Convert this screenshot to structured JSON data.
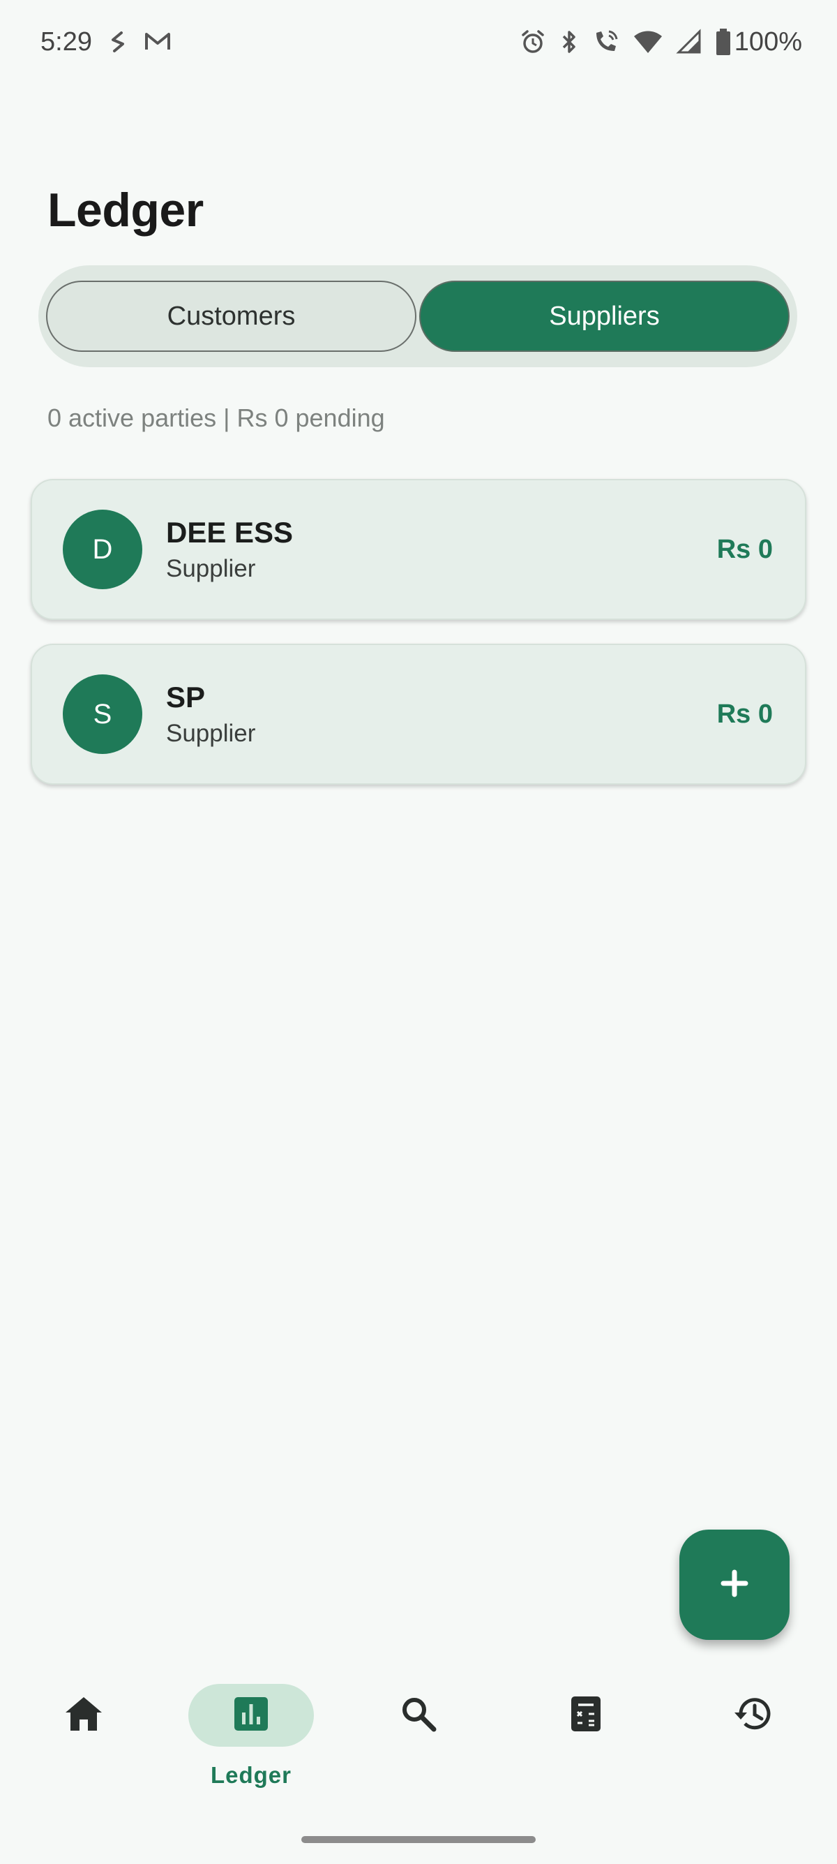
{
  "status_bar": {
    "time": "5:29",
    "battery": "100%",
    "left_icons": [
      "s-app-icon",
      "gmail-icon"
    ],
    "right_icons": [
      "alarm-icon",
      "bluetooth-icon",
      "wifi-calling-icon",
      "wifi-icon",
      "signal-icon",
      "battery-icon"
    ]
  },
  "page": {
    "title": "Ledger"
  },
  "segmented": {
    "customers_label": "Customers",
    "suppliers_label": "Suppliers",
    "selected": "Suppliers"
  },
  "summary": "0 active parties | Rs 0 pending",
  "parties": [
    {
      "initial": "D",
      "name": "DEE ESS",
      "type": "Supplier",
      "amount": "Rs 0"
    },
    {
      "initial": "S",
      "name": "SP",
      "type": "Supplier",
      "amount": "Rs 0"
    }
  ],
  "fab": {
    "icon": "plus-icon"
  },
  "bottom_nav": {
    "items": [
      {
        "icon": "home-icon"
      },
      {
        "icon": "ledger-chart-icon",
        "label": "Ledger",
        "active": true
      },
      {
        "icon": "search-icon"
      },
      {
        "icon": "calculator-icon"
      },
      {
        "icon": "history-icon"
      }
    ]
  },
  "colors": {
    "accent": "#1f7a58",
    "background": "#f6f9f7",
    "card": "#e6efea",
    "nav_pill": "#cde6d8"
  }
}
